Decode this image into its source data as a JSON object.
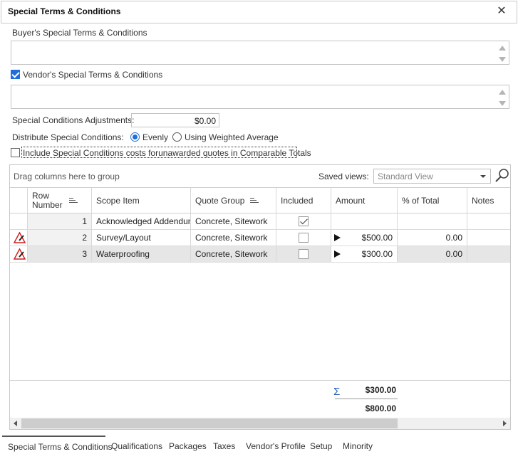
{
  "window": {
    "title": "Special Terms & Conditions"
  },
  "buyer_terms": {
    "label": "Buyer's Special Terms & Conditions",
    "value": ""
  },
  "vendor_terms": {
    "label": "Vendor's Special Terms & Conditions",
    "checked": true,
    "value": ""
  },
  "adjustments": {
    "label": "Special Conditions Adjustments:",
    "value": "$0.00"
  },
  "distribute": {
    "label": "Distribute Special Conditions:",
    "options": [
      {
        "label": "Evenly",
        "selected": true
      },
      {
        "label": "Using Weighted Average",
        "selected": false
      }
    ]
  },
  "include_costs": {
    "label": "Include Special Conditions costs forunawarded quotes in Comparable Totals",
    "checked": false
  },
  "grid": {
    "group_hint": "Drag columns here to group",
    "saved_views_label": "Saved views:",
    "saved_view_value": "Standard View",
    "columns": {
      "row_number": "Row Number",
      "scope_item": "Scope Item",
      "quote_group": "Quote Group",
      "included": "Included",
      "amount": "Amount",
      "pct_total": "% of Total",
      "notes": "Notes"
    },
    "rows": [
      {
        "row_number": "1",
        "scope_item": "Acknowledged Addendum",
        "quote_group": "Concrete, Sitework",
        "included": true,
        "amount": "",
        "pct_total": "",
        "notes": "",
        "warning": false
      },
      {
        "row_number": "2",
        "scope_item": "Survey/Layout",
        "quote_group": "Concrete, Sitework",
        "included": false,
        "amount": "$500.00",
        "pct_total": "0.00",
        "notes": "",
        "warning": true
      },
      {
        "row_number": "3",
        "scope_item": "Waterproofing",
        "quote_group": "Concrete, Sitework",
        "included": false,
        "amount": "$300.00",
        "pct_total": "0.00",
        "notes": "",
        "warning": true
      }
    ],
    "summary_total": "$300.00",
    "grand_total": "$800.00"
  },
  "tabs": [
    {
      "label": "Special Terms & Conditions",
      "active": true
    },
    {
      "label": "Qualifications",
      "active": false
    },
    {
      "label": "Packages",
      "active": false
    },
    {
      "label": "Taxes",
      "active": false
    },
    {
      "label": "Vendor's Profile",
      "active": false
    },
    {
      "label": "Setup",
      "active": false
    },
    {
      "label": "Minority",
      "active": false
    }
  ]
}
